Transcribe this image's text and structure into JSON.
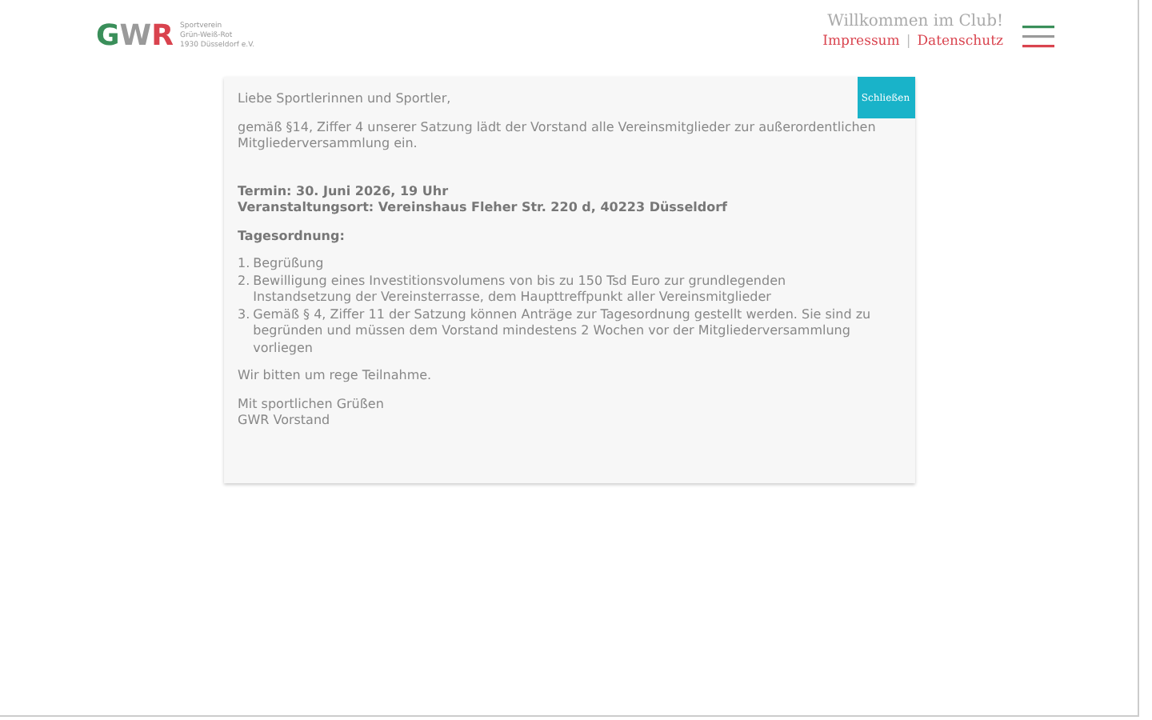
{
  "logo": {
    "letters": [
      {
        "text": "G",
        "color": "#3a8f5a"
      },
      {
        "text": "W",
        "color": "#9a9a9a"
      },
      {
        "text": "R",
        "color": "#d9434e"
      }
    ],
    "tagline": [
      "Sportverein",
      "Grün-Weiß-Rot",
      "1930 Düsseldorf e.V."
    ]
  },
  "header": {
    "welcome": "Willkommen im Club!",
    "links": [
      "Impressum",
      "Datenschutz"
    ],
    "separator": "|"
  },
  "notice": {
    "close_button": "Schließen",
    "greeting": "Liebe Sportlerinnen und Sportler,",
    "intro": "gemäß §14, Ziffer 4 unserer Satzung lädt der Vorstand alle Vereinsmitglieder zur außerordentlichen Mitgliederversammlung ein.",
    "date": "Termin: 30. Juni 2026, 19 Uhr",
    "venue": "Veranstaltungsort: Vereinshaus Fleher Str. 220 d, 40223 Düsseldorf",
    "agenda_title": "Tagesordnung:",
    "agenda": [
      {
        "number": "1.",
        "text": "Begrüßung"
      },
      {
        "number": "2.",
        "text": "Bewilligung eines Investitionsvolumens von bis zu 150 Tsd Euro zur grundlegenden Instandsetzung der Vereinsterrasse, dem Haupttreffpunkt aller Vereinsmitglieder"
      },
      {
        "number": "3.",
        "text": "Gemäß § 4, Ziffer 11 der Satzung können Anträge zur Tagesordnung gestellt werden. Sie sind zu begründen und müssen dem Vorstand mindestens 2 Wochen vor der Mitgliederversammlung vorliegen"
      }
    ],
    "request": "Wir bitten um rege Teilnahme.",
    "closing": [
      "Mit sportlichen Grüßen",
      "GWR Vorstand"
    ]
  }
}
